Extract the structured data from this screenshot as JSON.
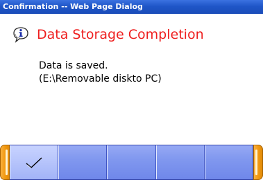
{
  "window": {
    "title": "Confirmation -- Web Page Dialog"
  },
  "dialog": {
    "icon": "info-icon",
    "heading": "Data Storage Completion",
    "message_lines": [
      "Data is saved.",
      "(E:\\Removable diskto PC)"
    ]
  },
  "softkeys": [
    {
      "label": "",
      "icon": "checkmark-icon"
    },
    {
      "label": ""
    },
    {
      "label": ""
    },
    {
      "label": ""
    },
    {
      "label": ""
    }
  ],
  "colors": {
    "titlebar": "#1f56c8",
    "heading": "#ee1e1e",
    "softkey_blue": "#8198ef",
    "cap_orange": "#f39a12"
  }
}
